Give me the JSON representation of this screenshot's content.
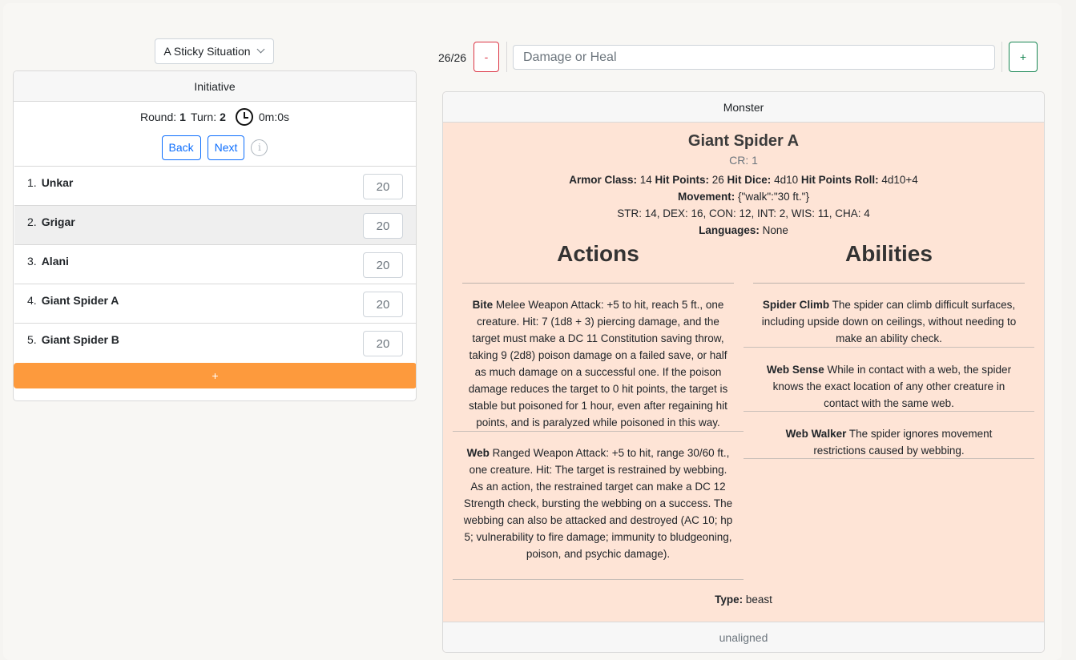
{
  "scenario": {
    "selected": "A Sticky Situation"
  },
  "initiative": {
    "header": "Initiative",
    "round_label": "Round:",
    "round": "1",
    "turn_label": "Turn:",
    "turn": "2",
    "timer": "0m:0s",
    "back_label": "Back",
    "next_label": "Next",
    "info_glyph": "i",
    "add_label": "+",
    "items": [
      {
        "num": "1.",
        "name": "Unkar",
        "value": "20"
      },
      {
        "num": "2.",
        "name": "Grigar",
        "value": "20"
      },
      {
        "num": "3.",
        "name": "Alani",
        "value": "20"
      },
      {
        "num": "4.",
        "name": "Giant Spider A",
        "value": "20"
      },
      {
        "num": "5.",
        "name": "Giant Spider B",
        "value": "20"
      }
    ]
  },
  "hp": {
    "text": "26/26",
    "minus_label": "-",
    "plus_label": "+",
    "placeholder": "Damage or Heal"
  },
  "monster": {
    "header": "Monster",
    "name": "Giant Spider A",
    "cr": "CR: 1",
    "ac_label": "Armor Class:",
    "ac": " 14 ",
    "hp_label": "Hit Points:",
    "hp": " 26 ",
    "hd_label": "Hit Dice:",
    "hd": " 4d10 ",
    "hpr_label": "Hit Points Roll:",
    "hpr": " 4d10+4",
    "movement_label": "Movement:",
    "movement": " {\"walk\":\"30 ft.\"}",
    "scores": "STR: 14, DEX: 16, CON: 12, INT: 2, WIS: 11, CHA: 4",
    "languages_label": "Languages:",
    "languages": " None",
    "actions_title": "Actions",
    "abilities_title": "Abilities",
    "actions": [
      {
        "name": "Bite",
        "text": " Melee Weapon Attack: +5 to hit, reach 5 ft., one creature. Hit: 7 (1d8 + 3) piercing damage, and the target must make a DC 11 Constitution saving throw, taking 9 (2d8) poison damage on a failed save, or half as much damage on a successful one. If the poison damage reduces the target to 0 hit points, the target is stable but poisoned for 1 hour, even after regaining hit points, and is paralyzed while poisoned in this way."
      },
      {
        "name": "Web",
        "text": " Ranged Weapon Attack: +5 to hit, range 30/60 ft., one creature. Hit: The target is restrained by webbing. As an action, the restrained target can make a DC 12 Strength check, bursting the webbing on a success. The webbing can also be attacked and destroyed (AC 10; hp 5; vulnerability to fire damage; immunity to bludgeoning, poison, and psychic damage)."
      }
    ],
    "abilities": [
      {
        "name": "Spider Climb",
        "text": " The spider can climb difficult surfaces, including upside down on ceilings, without needing to make an ability check."
      },
      {
        "name": "Web Sense",
        "text": " While in contact with a web, the spider knows the exact location of any other creature in contact with the same web."
      },
      {
        "name": "Web Walker",
        "text": " The spider ignores movement restrictions caused by webbing."
      }
    ],
    "type_label": "Type:",
    "type": " beast",
    "alignment": "unaligned"
  },
  "colors": {
    "add_button": "#fd9a3d",
    "monster_bg": "#fee4d6",
    "primary": "#0d6efd",
    "danger": "#dc3545",
    "success": "#198754"
  }
}
